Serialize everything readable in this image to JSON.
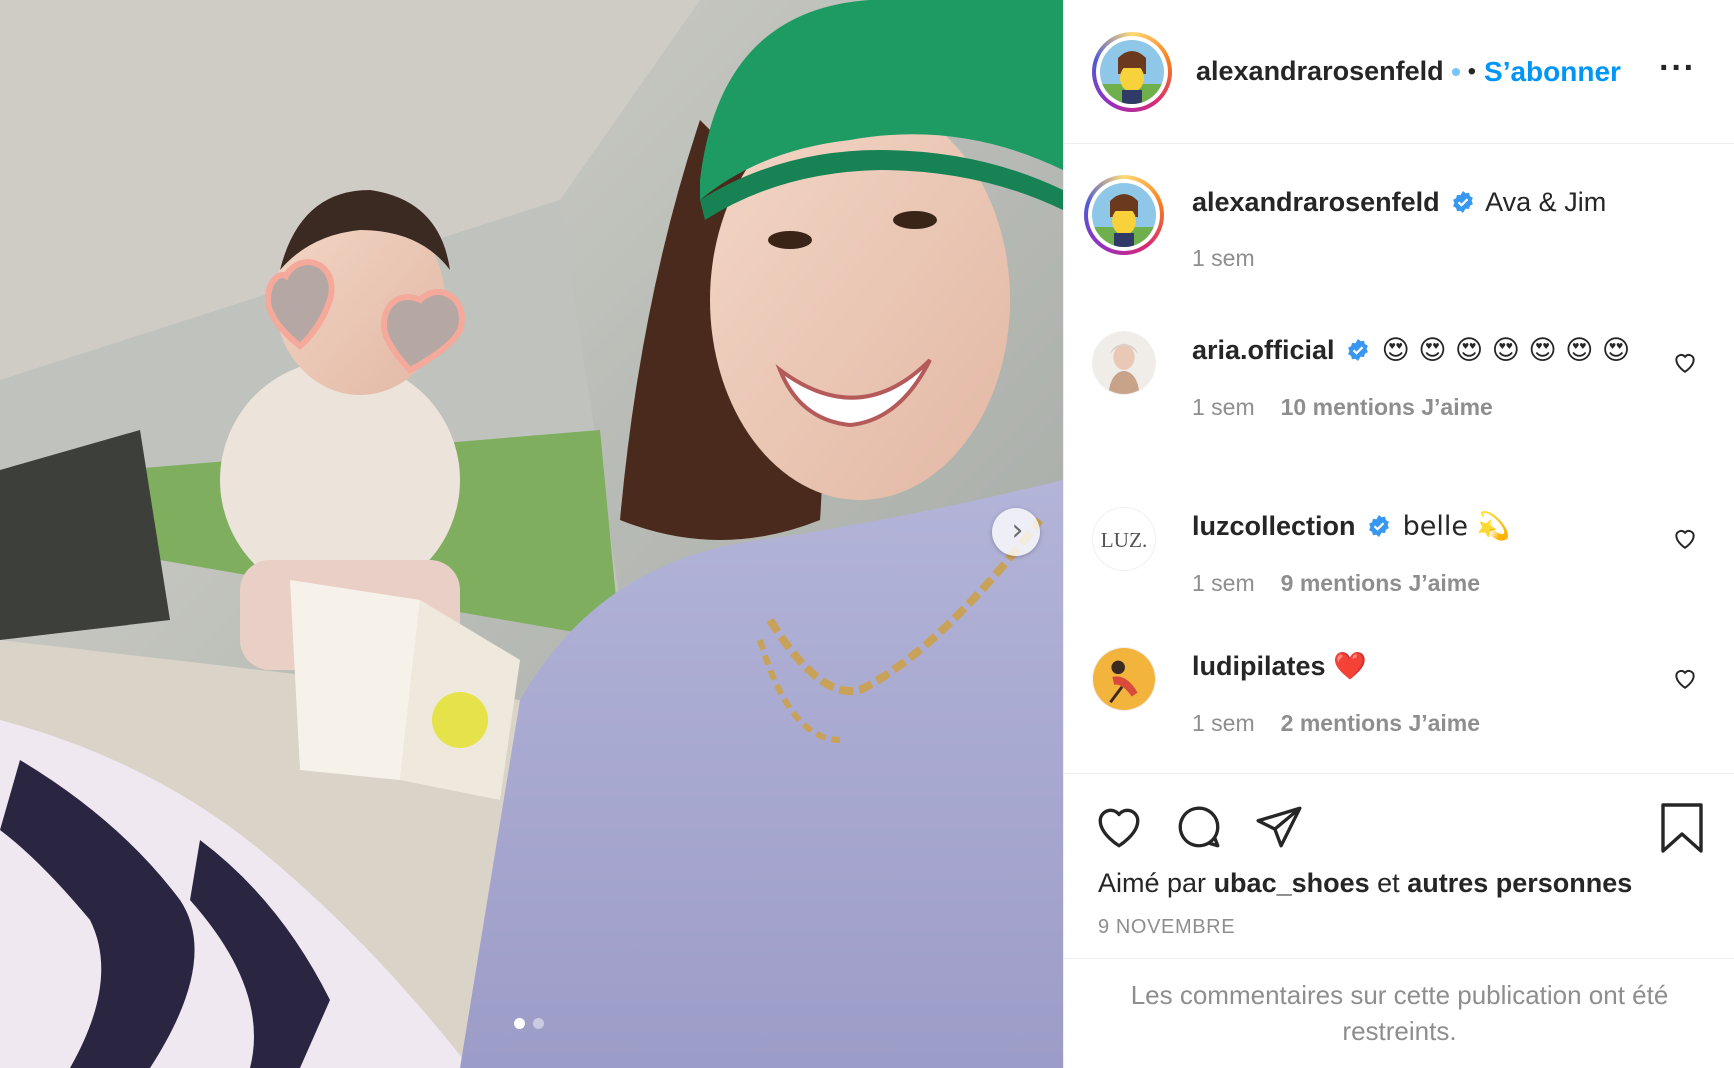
{
  "post": {
    "media": {
      "alt": "",
      "slide_index": 1,
      "slide_count": 2
    },
    "header": {
      "username": "alexandrarosenfeld",
      "separator": "•",
      "follow_label": "S’abonner",
      "more_label": "•••"
    },
    "caption": {
      "username": "alexandrarosenfeld",
      "text": "Ava & Jim",
      "time": "1 sem"
    },
    "comments": [
      {
        "username": "aria.official",
        "verified": true,
        "text": "😍 😍 😍 😍 😍 😍 😍",
        "time": "1 sem",
        "likes": "10 mentions J’aime"
      },
      {
        "username": "luzcollection",
        "verified": true,
        "text": "belle 💫",
        "time": "1 sem",
        "likes": "9 mentions J’aime"
      },
      {
        "username": "ludipilates",
        "verified": false,
        "text": "❤️",
        "time": "1 sem",
        "likes": "2 mentions J’aime"
      }
    ],
    "liked_by": {
      "prefix": "Aimé par",
      "user": "ubac_shoes",
      "conjunction": "et",
      "others": "autres personnes"
    },
    "date": "9 NOVEMBRE",
    "restricted_notice": "Les commentaires sur cette publication ont été restreints.",
    "colors": {
      "accent": "#0095f6",
      "text": "#262626",
      "muted": "#8e8e8e",
      "border": "#efefef"
    }
  }
}
